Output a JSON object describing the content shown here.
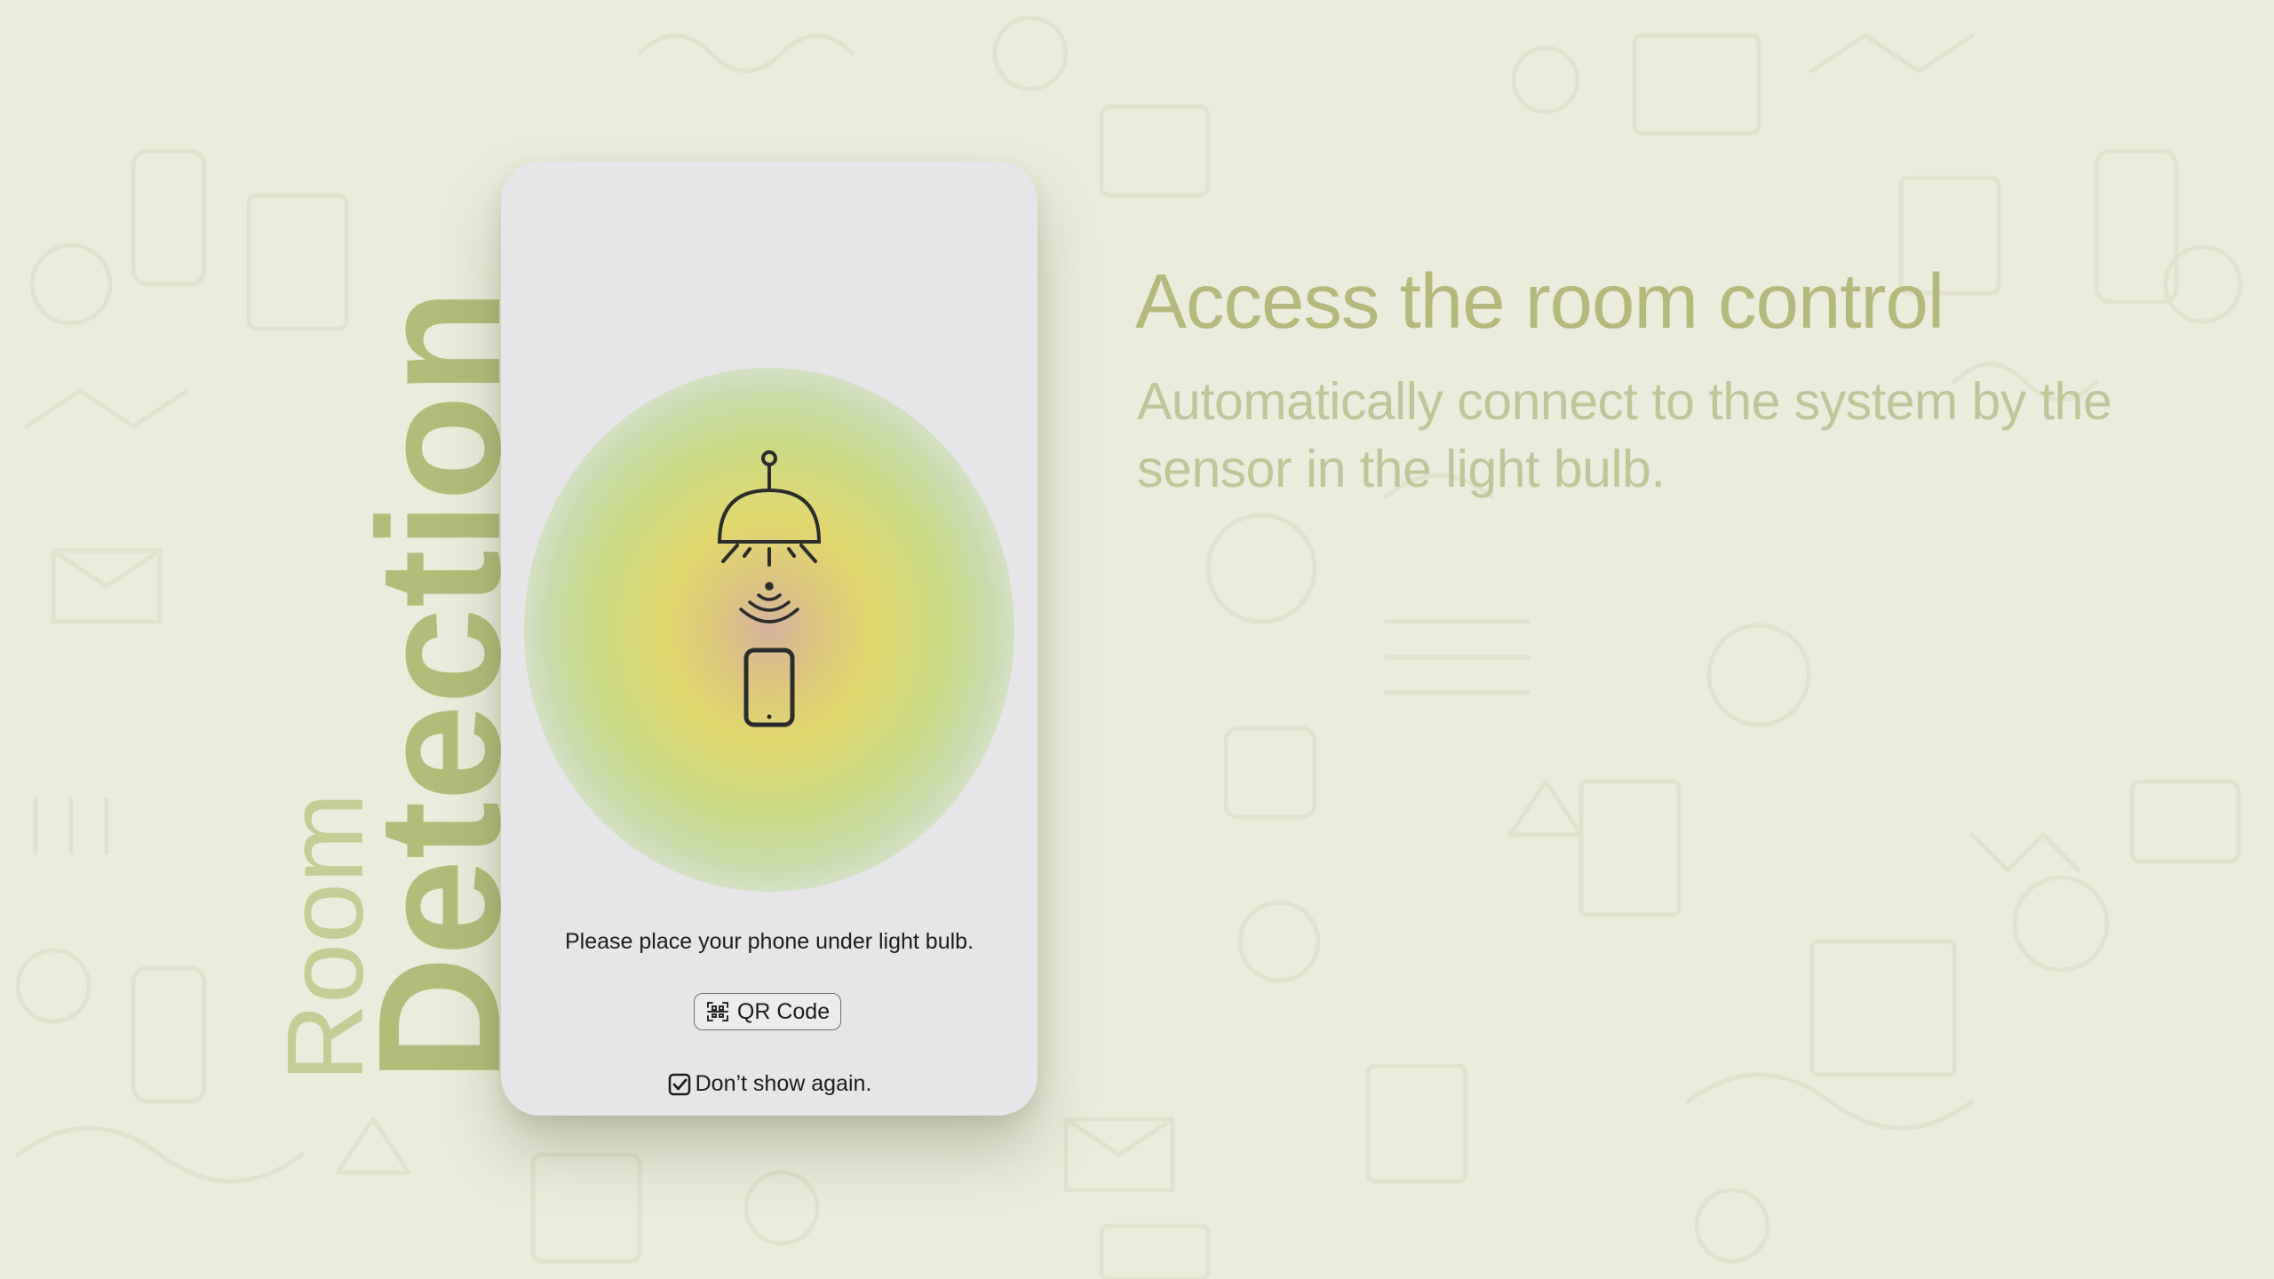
{
  "side_title": {
    "line1": "Room",
    "line2": "Detection"
  },
  "phone_screen": {
    "illustration": {
      "icons": [
        "ceiling-lamp-icon",
        "wireless-signal-icon",
        "smartphone-icon"
      ]
    },
    "instruction": "Please place your phone under light bulb.",
    "qr_button": {
      "label": "QR Code",
      "icon": "qr-scan-icon"
    },
    "dont_show_again": {
      "label": "Don’t show again.",
      "checked": true
    }
  },
  "feature": {
    "heading": "Access the room control",
    "description": "Automatically connect to the system by the sensor  in the light bulb."
  },
  "colors": {
    "background": "#ebeddc",
    "accent_olive": "#b5ba7c",
    "title_green": "#b3bd7a",
    "phone_screen": "#e6e6e8",
    "text_dark": "#1c1c1c"
  }
}
